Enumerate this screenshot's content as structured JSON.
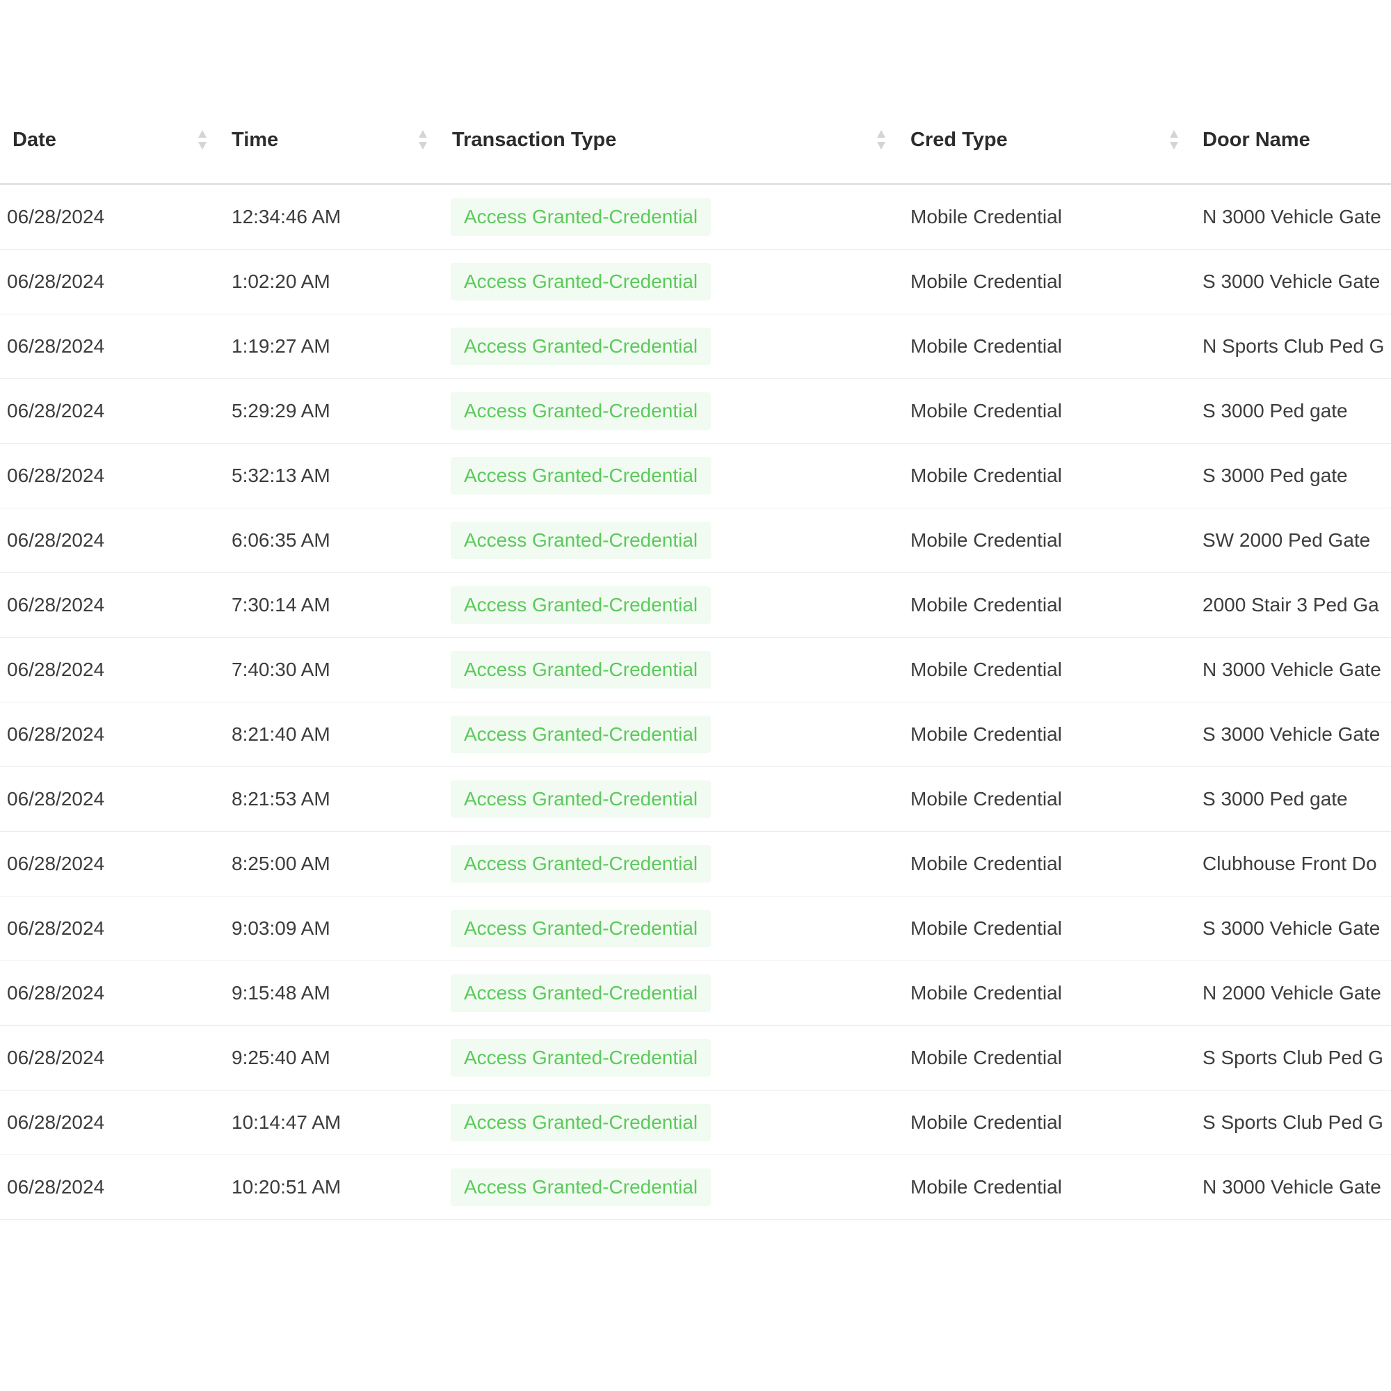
{
  "table": {
    "columns": [
      {
        "key": "date",
        "label": "Date",
        "sortable": true
      },
      {
        "key": "time",
        "label": "Time",
        "sortable": true
      },
      {
        "key": "transaction_type",
        "label": "Transaction Type",
        "sortable": true
      },
      {
        "key": "cred_type",
        "label": "Cred Type",
        "sortable": true
      },
      {
        "key": "door_name",
        "label": "Door Name",
        "sortable": false
      }
    ],
    "badge_color": "#5cc95c",
    "badge_background": "#f1fbf1",
    "rows": [
      {
        "date": "06/28/2024",
        "time": "12:34:46 AM",
        "transaction_type": "Access Granted-Credential",
        "cred_type": "Mobile Credential",
        "door_name": "N 3000 Vehicle Gate"
      },
      {
        "date": "06/28/2024",
        "time": "1:02:20 AM",
        "transaction_type": "Access Granted-Credential",
        "cred_type": "Mobile Credential",
        "door_name": "S 3000 Vehicle Gate"
      },
      {
        "date": "06/28/2024",
        "time": "1:19:27 AM",
        "transaction_type": "Access Granted-Credential",
        "cred_type": "Mobile Credential",
        "door_name": "N Sports Club Ped G"
      },
      {
        "date": "06/28/2024",
        "time": "5:29:29 AM",
        "transaction_type": "Access Granted-Credential",
        "cred_type": "Mobile Credential",
        "door_name": "S 3000 Ped gate"
      },
      {
        "date": "06/28/2024",
        "time": "5:32:13 AM",
        "transaction_type": "Access Granted-Credential",
        "cred_type": "Mobile Credential",
        "door_name": "S 3000 Ped gate"
      },
      {
        "date": "06/28/2024",
        "time": "6:06:35 AM",
        "transaction_type": "Access Granted-Credential",
        "cred_type": "Mobile Credential",
        "door_name": "SW 2000 Ped Gate"
      },
      {
        "date": "06/28/2024",
        "time": "7:30:14 AM",
        "transaction_type": "Access Granted-Credential",
        "cred_type": "Mobile Credential",
        "door_name": "2000 Stair 3 Ped Ga"
      },
      {
        "date": "06/28/2024",
        "time": "7:40:30 AM",
        "transaction_type": "Access Granted-Credential",
        "cred_type": "Mobile Credential",
        "door_name": "N 3000 Vehicle Gate"
      },
      {
        "date": "06/28/2024",
        "time": "8:21:40 AM",
        "transaction_type": "Access Granted-Credential",
        "cred_type": "Mobile Credential",
        "door_name": "S 3000 Vehicle Gate"
      },
      {
        "date": "06/28/2024",
        "time": "8:21:53 AM",
        "transaction_type": "Access Granted-Credential",
        "cred_type": "Mobile Credential",
        "door_name": "S 3000 Ped gate"
      },
      {
        "date": "06/28/2024",
        "time": "8:25:00 AM",
        "transaction_type": "Access Granted-Credential",
        "cred_type": "Mobile Credential",
        "door_name": "Clubhouse Front Do"
      },
      {
        "date": "06/28/2024",
        "time": "9:03:09 AM",
        "transaction_type": "Access Granted-Credential",
        "cred_type": "Mobile Credential",
        "door_name": "S 3000 Vehicle Gate"
      },
      {
        "date": "06/28/2024",
        "time": "9:15:48 AM",
        "transaction_type": "Access Granted-Credential",
        "cred_type": "Mobile Credential",
        "door_name": "N 2000 Vehicle Gate"
      },
      {
        "date": "06/28/2024",
        "time": "9:25:40 AM",
        "transaction_type": "Access Granted-Credential",
        "cred_type": "Mobile Credential",
        "door_name": "S Sports Club Ped G"
      },
      {
        "date": "06/28/2024",
        "time": "10:14:47 AM",
        "transaction_type": "Access Granted-Credential",
        "cred_type": "Mobile Credential",
        "door_name": "S Sports Club Ped G"
      },
      {
        "date": "06/28/2024",
        "time": "10:20:51 AM",
        "transaction_type": "Access Granted-Credential",
        "cred_type": "Mobile Credential",
        "door_name": "N 3000 Vehicle Gate"
      }
    ]
  }
}
